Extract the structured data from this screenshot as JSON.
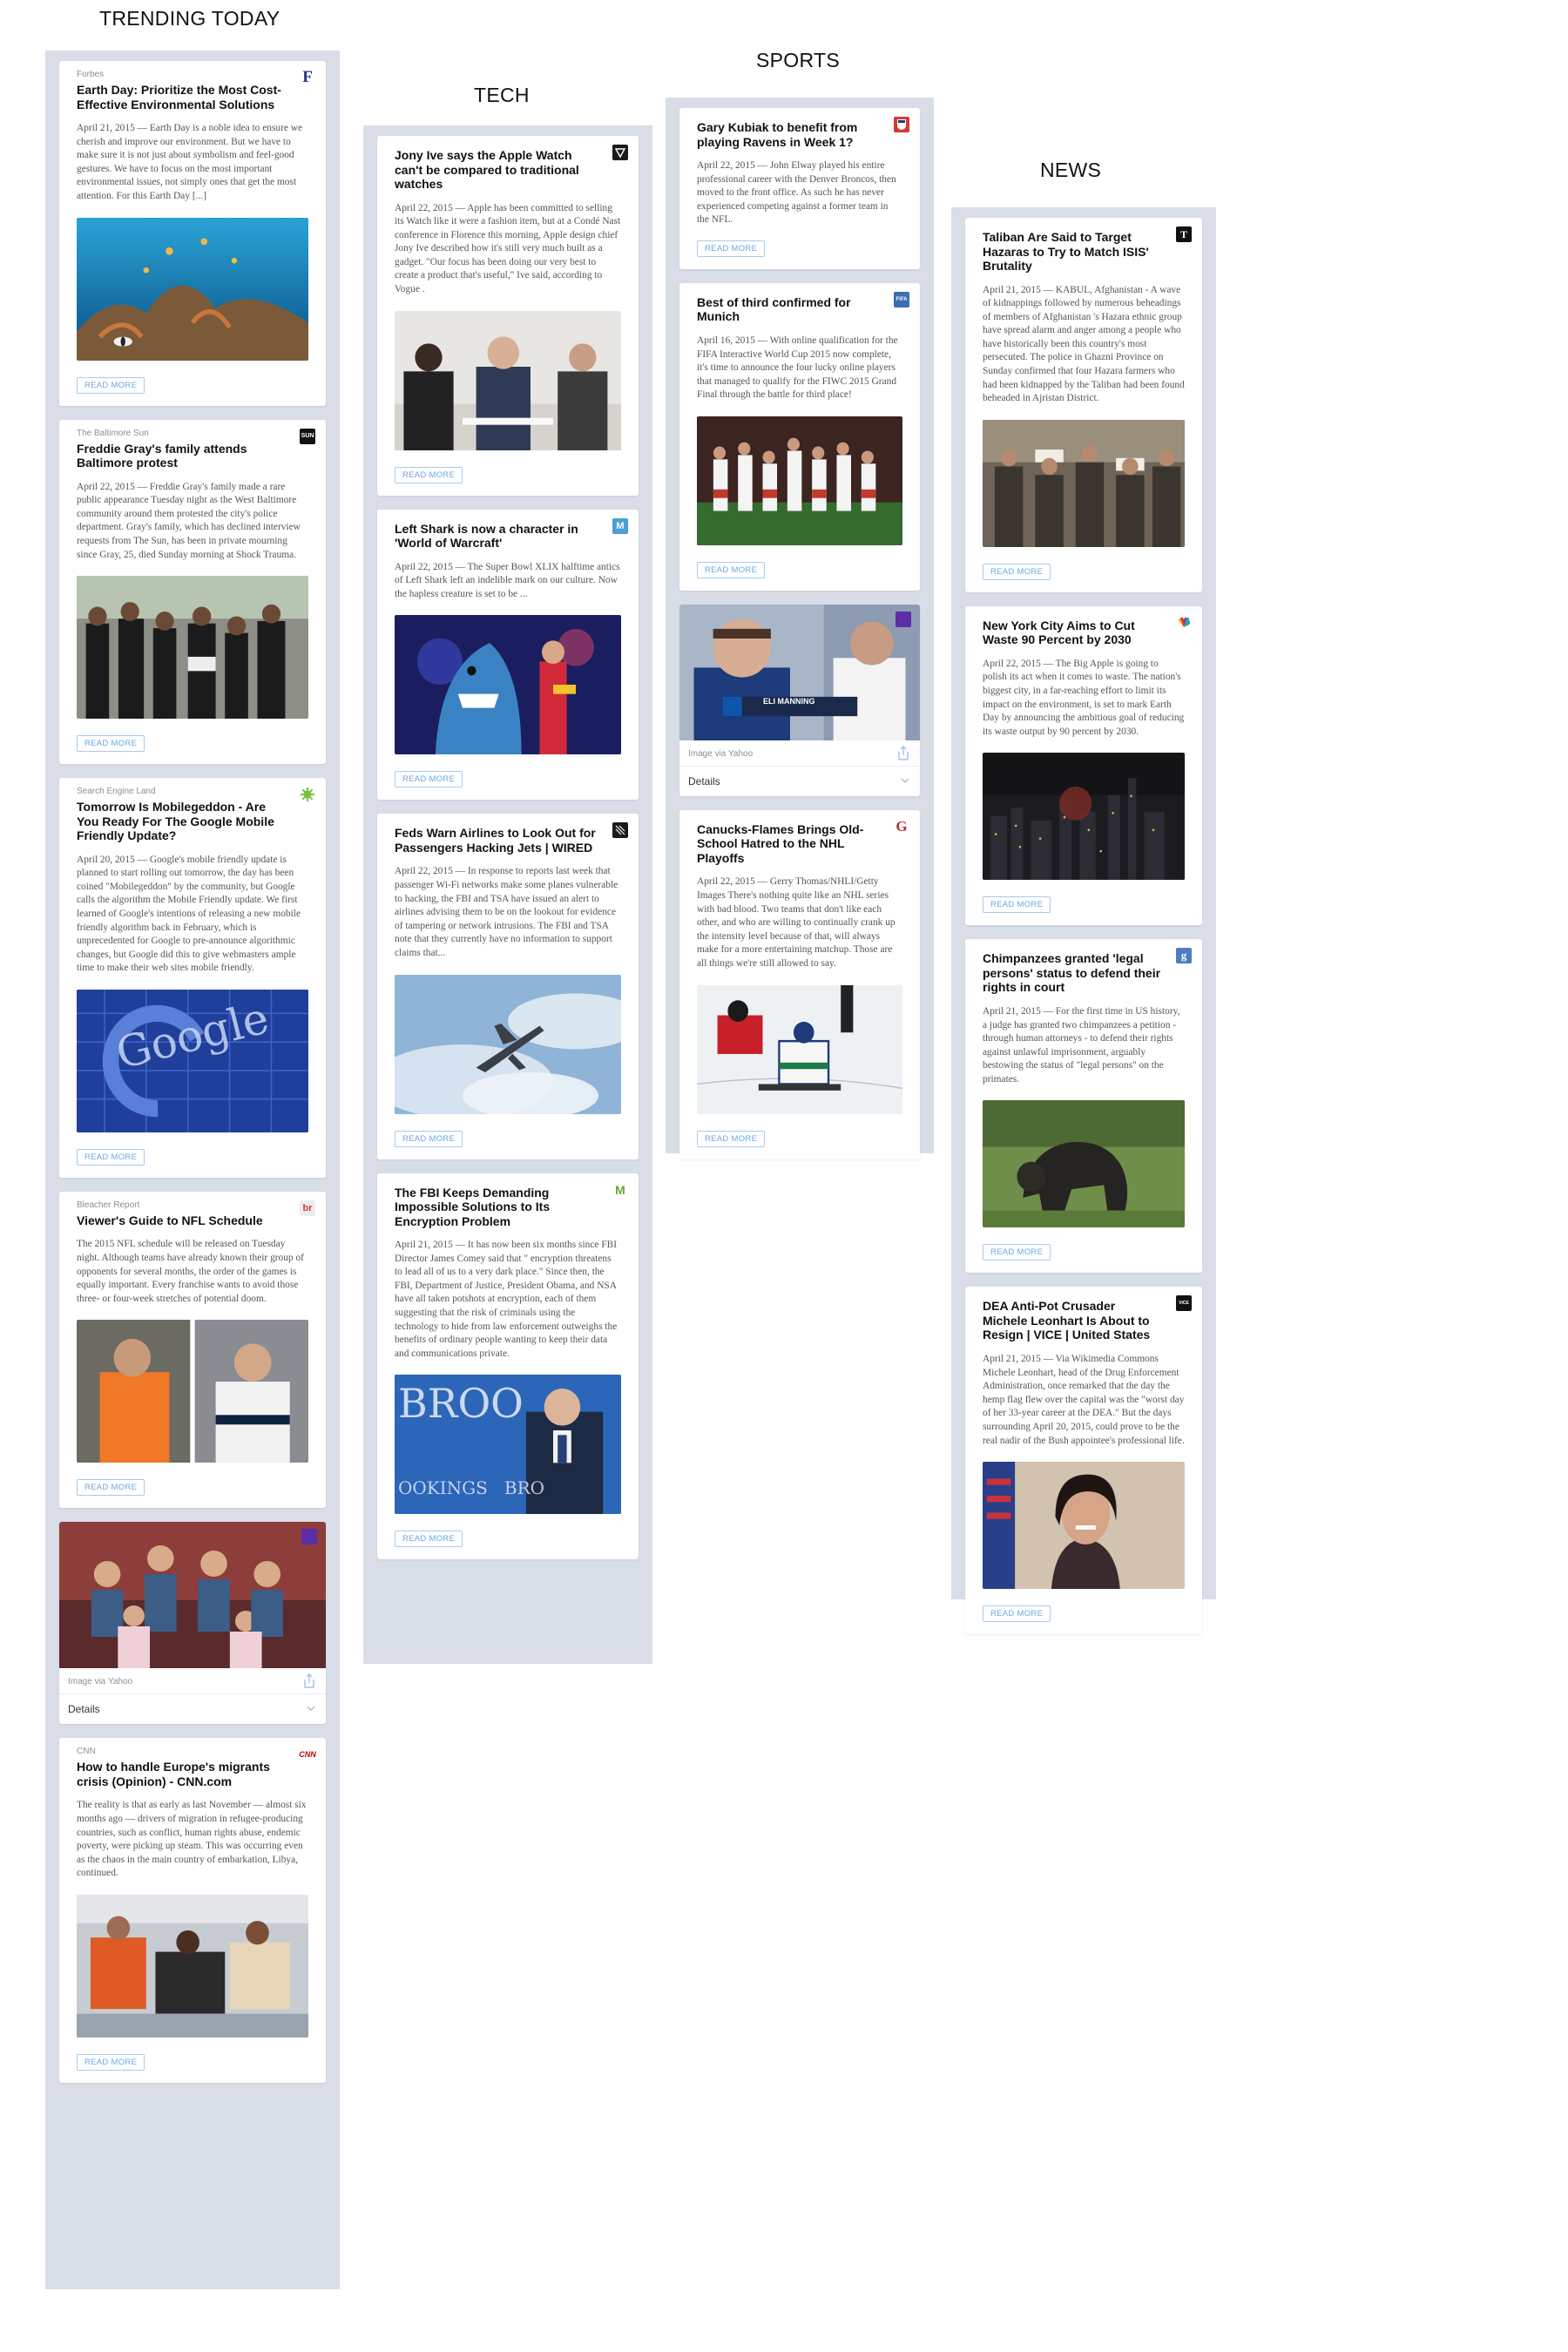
{
  "columns": {
    "trending": {
      "title": "TRENDING TODAY",
      "cards": [
        {
          "source": "Forbes",
          "headline": "Earth Day: Prioritize the Most Cost-Effective Environmental Solutions",
          "body": "April 21, 2015 — Earth Day is a noble idea to ensure we cherish and improve our environment. But we have to make sure it is not just about symbolism and feel-good gestures. We have to focus on the most important environmental issues, not simply ones that get the most attention. For this Earth Day [...]",
          "logo": "F",
          "button": "READ MORE"
        },
        {
          "source": "The Baltimore Sun",
          "headline": "Freddie Gray's family attends Baltimore protest",
          "body": "April 22, 2015 — Freddie Gray's family made a rare public appearance Tuesday night as the West Baltimore community around them protested the city's police department. Gray's family, which has declined interview requests from The Sun, has been in private mourning since Gray, 25, died Sunday morning at Shock Trauma.",
          "logo": "SUN",
          "button": "READ MORE"
        },
        {
          "source": "Search Engine Land",
          "headline": "Tomorrow Is Mobilegeddon - Are You Ready For The Google Mobile Friendly Update?",
          "body": "April 20, 2015 — Google's mobile friendly update is planned to start rolling out tomorrow, the day has been coined \"Mobilegeddon\" by the community, but Google calls the algorithm the Mobile Friendly update. We first learned of Google's intentions of releasing a new mobile friendly algorithm back in February, which is unprecedented for Google to pre-announce algorithmic changes, but Google did this to give webmasters ample time to make their web sites mobile friendly.",
          "photo_text": "Google",
          "button": "READ MORE"
        },
        {
          "source": "Bleacher Report",
          "headline": "Viewer's Guide to NFL Schedule",
          "body": "The 2015 NFL schedule will be released on Tuesday night. Although teams have already known their group of opponents for several months, the order of the games is equally important. Every franchise wants to avoid those three- or four-week stretches of potential doom.",
          "logo": "br",
          "button": "READ MORE"
        },
        {
          "caption": "Image via Yahoo",
          "details": "Details"
        },
        {
          "source": "CNN",
          "headline": "How to handle Europe's migrants crisis (Opinion) - CNN.com",
          "body": "The reality is that as early as last November — almost six months ago — drivers of migration in refugee-producing countries, such as conflict, human rights abuse, endemic poverty, were picking up steam. This was occurring even as the chaos in the main country of embarkation, Libya, continued.",
          "logo": "CNN",
          "button": "READ MORE"
        }
      ]
    },
    "tech": {
      "title": "TECH",
      "cards": [
        {
          "headline": "Jony Ive says the Apple Watch can't be compared to traditional watches",
          "body": "April 22, 2015 — Apple has been committed to selling its Watch like it were a fashion item, but at a Condé Nast conference in Florence this morning, Apple design chief Jony Ive described how it's still very much built as a gadget. \"Our focus has been doing our very best to create a product that's useful,\" Ive said, according to Vogue .",
          "button": "READ MORE"
        },
        {
          "headline": "Left Shark is now a character in 'World of Warcraft'",
          "body": "April 22, 2015 — The Super Bowl XLIX halftime antics of Left Shark left an indelible mark on our culture. Now the hapless creature is set to be ...",
          "logo": "M",
          "button": "READ MORE"
        },
        {
          "headline": "Feds Warn Airlines to Look Out for Passengers Hacking Jets | WIRED",
          "body": "April 22, 2015 — In response to reports last week that passenger Wi-Fi networks make some planes vulnerable to hacking, the FBI and TSA have issued an alert to airlines advising them to be on the lookout for evidence of tampering or network intrusions. The FBI and TSA note that they currently have no information to support claims that...",
          "button": "READ MORE"
        },
        {
          "headline": "The FBI Keeps Demanding Impossible Solutions to Its Encryption Problem",
          "body": "April 21, 2015 — It has now been six months since FBI Director James Comey said that \" encryption threatens to lead all of us to a very dark place.\" Since then, the FBI, Department of Justice, President Obama, and NSA have all taken potshots at encryption, each of them suggesting that the risk of criminals using the technology to hide from law enforcement outweighs the benefits of ordinary people wanting to keep their data and communications private.",
          "logo": "M",
          "photo_text": "BROO",
          "photo_text2": "OOKINGS   BRO",
          "button": "READ MORE"
        }
      ]
    },
    "sports": {
      "title": "SPORTS",
      "cards": [
        {
          "headline": "Gary Kubiak to benefit from playing Ravens in Week 1?",
          "body": "April 22, 2015 — John Elway played his entire professional career with the Denver Broncos, then moved to the front office. As such he has never experienced competing against a former team in the NFL.",
          "button": "READ MORE"
        },
        {
          "headline": "Best of third confirmed for Munich",
          "body": "April 16, 2015 — With online qualification for the FIFA Interactive World Cup 2015 now complete, it's time to announce the four lucky online players that managed to qualify for the FIWC 2015 Grand Final through the battle for third place!",
          "logo": "FIFA",
          "button": "READ MORE"
        },
        {
          "caption": "Image via Yahoo",
          "details": "Details",
          "ticker": "ELI MANNING"
        },
        {
          "headline": "Canucks-Flames Brings Old-School Hatred to the NHL Playoffs",
          "body": "April 22, 2015 — Gerry Thomas/NHLI/Getty Images There's nothing quite like an NHL series with bad blood. Two teams that don't like each other, and who are willing to continually crank up the intensity level because of that, will always make for a more entertaining matchup. Those are all things we're still allowed to say.",
          "logo": "G",
          "button": "READ MORE"
        }
      ]
    },
    "news": {
      "title": "NEWS",
      "cards": [
        {
          "headline": "Taliban Are Said to Target Hazaras to Try to Match ISIS' Brutality",
          "body": "April 21, 2015 — KABUL, Afghanistan - A wave of kidnappings followed by numerous beheadings of members of Afghanistan 's Hazara ethnic group have spread alarm and anger among a people who have historically been this country's most persecuted. The police in Ghazni Province on Sunday confirmed that four Hazara farmers who had been kidnapped by the Taliban had been found beheaded in Ajristan District.",
          "logo": "T",
          "button": "READ MORE"
        },
        {
          "headline": "New York City Aims to Cut Waste 90 Percent by 2030",
          "body": "April 22, 2015 — The Big Apple is going to polish its act when it comes to waste. The nation's biggest city, in a far-reaching effort to limit its impact on the environment, is set to mark Earth Day by announcing the ambitious goal of reducing its waste output by 90 percent by 2030.",
          "button": "READ MORE"
        },
        {
          "headline": "Chimpanzees granted 'legal persons' status to defend their rights in court",
          "body": "April 21, 2015 — For the first time in US history, a judge has granted two chimpanzees a petition - through human attorneys - to defend their rights against unlawful imprisonment, arguably bestowing the status of \"legal persons\" on the primates.",
          "logo": "g",
          "button": "READ MORE"
        },
        {
          "headline": "DEA Anti-Pot Crusader Michele Leonhart Is About to Resign | VICE | United States",
          "body": "April 21, 2015 — Via Wikimedia Commons Michele Leonhart, head of the Drug Enforcement Administration, once remarked that the day the hemp flag flew over the capital was the \"worst day of her 33-year career at the DEA.\" But the days surrounding April 20, 2015, could prove to be the real nadir of the Bush appointee's professional life.",
          "logo": "VICE",
          "button": "READ MORE"
        }
      ]
    }
  }
}
